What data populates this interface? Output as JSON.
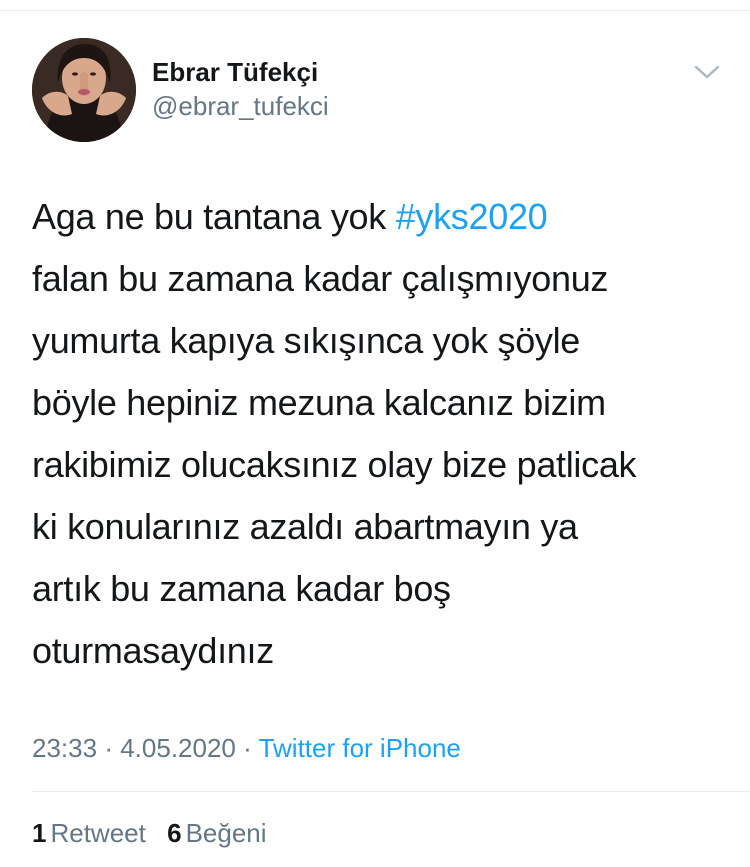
{
  "tweet": {
    "author": {
      "display_name": "Ebrar Tüfekçi",
      "handle": "@ebrar_tufekci"
    },
    "text_lines": [
      {
        "before": "Aga ne bu tantana yok ",
        "hashtag": "#yks2020"
      },
      {
        "text": "falan bu zamana kadar çalışmıyonuz"
      },
      {
        "text": "yumurta kapıya sıkışınca yok şöyle"
      },
      {
        "text": "böyle hepiniz mezuna kalcanız bizim"
      },
      {
        "text": "rakibimiz olucaksınız olay bize patlicak"
      },
      {
        "text": "ki konularınız azaldı abartmayın ya"
      },
      {
        "text": "artık bu zamana kadar boş"
      },
      {
        "text": "oturmasaydınız"
      }
    ],
    "meta": {
      "time": "23:33",
      "separator": "·",
      "date": "4.05.2020",
      "source": "Twitter for iPhone"
    },
    "stats": {
      "retweets_count": "1",
      "retweets_label": "Retweet",
      "likes_count": "6",
      "likes_label": "Beğeni"
    }
  },
  "icons": {
    "menu": "chevron-down-icon"
  },
  "colors": {
    "accent": "#1da1f2",
    "text_primary": "#14171a",
    "text_secondary": "#657786",
    "divider": "#e6ecf0"
  }
}
